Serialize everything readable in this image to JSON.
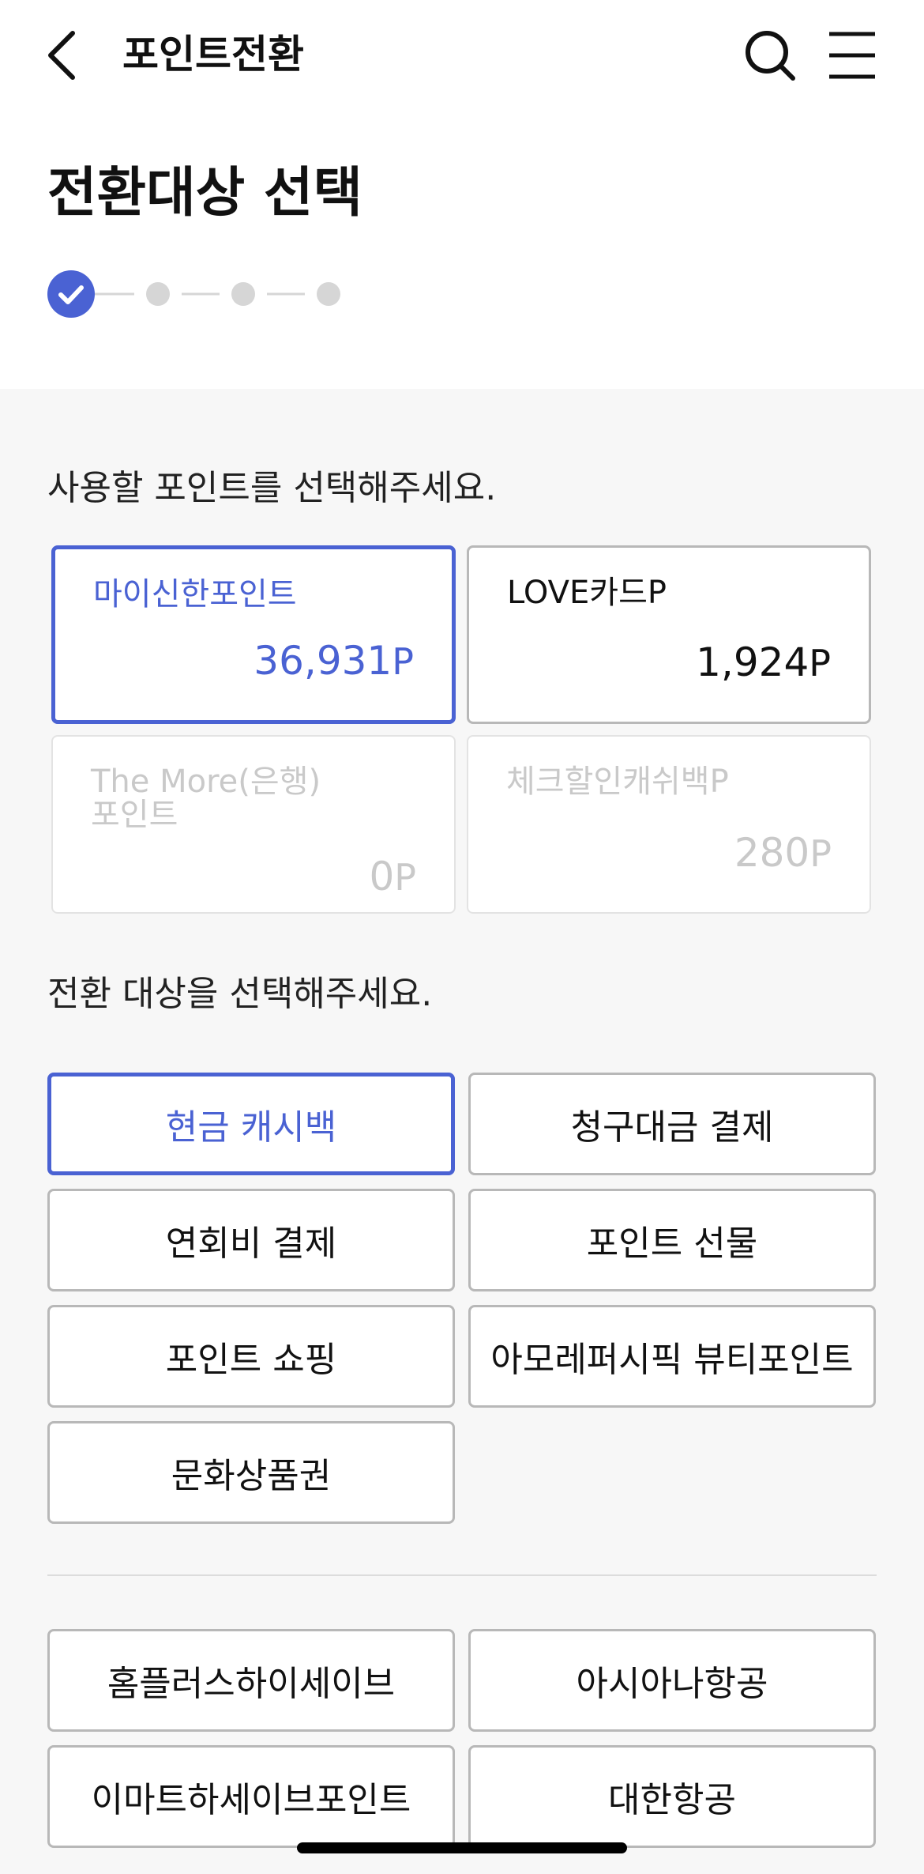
{
  "header": {
    "title": "포인트전환",
    "back_icon": "chevron-left-icon",
    "search_icon": "search-icon",
    "menu_icon": "hamburger-menu-icon"
  },
  "page": {
    "title": "전환대상 선택",
    "steps_total": 4,
    "current_step": 1
  },
  "points_section": {
    "label": "사용할 포인트를 선택해주세요.",
    "cards": [
      {
        "name": "마이신한포인트",
        "amount": "36,931",
        "unit": "P",
        "state": "selected"
      },
      {
        "name": "LOVE카드P",
        "amount": "1,924",
        "unit": "P",
        "state": "enabled"
      },
      {
        "name": "The More(은행) 포인트",
        "amount": "0",
        "unit": "P",
        "state": "disabled"
      },
      {
        "name": "체크할인캐쉬백P",
        "amount": "280",
        "unit": "P",
        "state": "disabled"
      }
    ]
  },
  "targets_section": {
    "label": "전환 대상을 선택해주세요.",
    "options": [
      {
        "label": "현금 캐시백",
        "selected": true
      },
      {
        "label": "청구대금 결제",
        "selected": false
      },
      {
        "label": "연회비 결제",
        "selected": false
      },
      {
        "label": "포인트 선물",
        "selected": false
      },
      {
        "label": "포인트 쇼핑",
        "selected": false
      },
      {
        "label": "아모레퍼시픽 뷰티포인트",
        "selected": false
      },
      {
        "label": "문화상품권",
        "selected": false
      }
    ],
    "partners": [
      {
        "label": "홈플러스하이세이브"
      },
      {
        "label": "아시아나항공"
      },
      {
        "label": "이마트하세이브포인트"
      },
      {
        "label": "대한항공"
      }
    ]
  },
  "colors": {
    "accent": "#4a62d3",
    "step_inactive": "#d6d6d6",
    "border": "#b8b8b8",
    "disabled_text": "#c9c9c9",
    "background": "#f7f7f7"
  }
}
